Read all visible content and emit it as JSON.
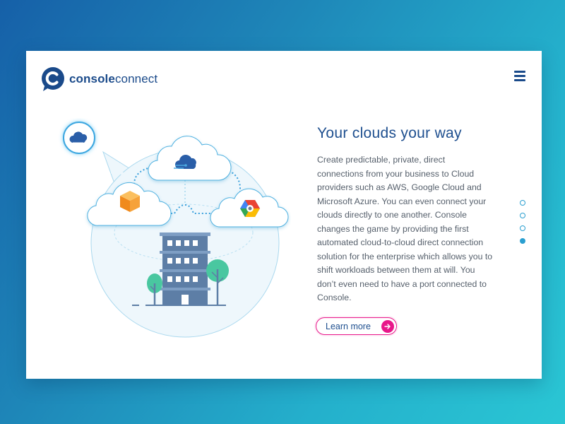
{
  "brand": {
    "name_bold": "console",
    "name_light": "connect"
  },
  "icons": {
    "logo": "console-connect-logo",
    "menu": "hamburger-menu-icon",
    "arrow": "arrow-right-icon"
  },
  "hero": {
    "title": "Your clouds your way",
    "description": "Create predictable, private, direct connections from your business to Cloud providers such as AWS, Google Cloud and Microsoft Azure. You can even connect your clouds directly to one another. Console changes the game by providing the first automated cloud-to-cloud direct connection solution for the enterprise which allows you to shift workloads between them at will. You don’t even need to have a port connected to Console.",
    "cta_label": "Learn more"
  },
  "pagination": {
    "slide_count": 4,
    "active_index": 3
  },
  "colors": {
    "brand_blue": "#1a4a8a",
    "accent_pink": "#e8178a",
    "dot_blue": "#2a9fd0",
    "bg_gradient_start": "#1660a8",
    "bg_gradient_end": "#2ac6d4"
  }
}
